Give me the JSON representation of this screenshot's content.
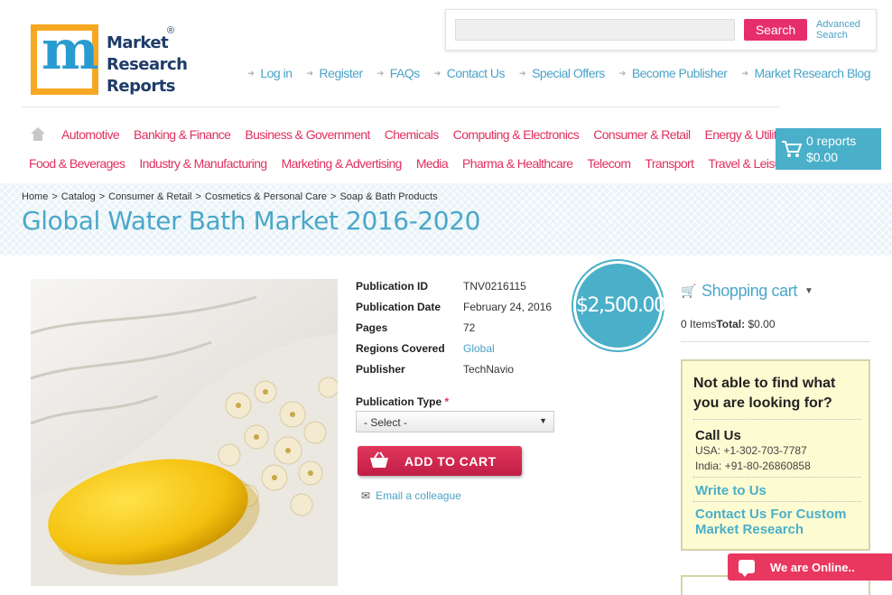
{
  "brand": {
    "line1": "Market",
    "line2": "Research",
    "line3": "Reports",
    "reg": "®"
  },
  "search": {
    "placeholder": "",
    "button": "Search",
    "advanced_line1": "Advanced",
    "advanced_line2": "Search"
  },
  "top_links": [
    "Log in",
    "Register",
    "FAQs",
    "Contact Us",
    "Special Offers",
    "Become Publisher",
    "Market Research Blog"
  ],
  "categories_row1": [
    "Automotive",
    "Banking & Finance",
    "Business & Government",
    "Chemicals",
    "Computing & Electronics",
    "Consumer & Retail",
    "Energy & Utilities"
  ],
  "categories_row2": [
    "Food & Beverages",
    "Industry & Manufacturing",
    "Marketing & Advertising",
    "Media",
    "Pharma & Healthcare",
    "Telecom",
    "Transport",
    "Travel & Leisure"
  ],
  "cart": {
    "reports": "0 reports",
    "total": "$0.00"
  },
  "breadcrumb": [
    "Home",
    "Catalog",
    "Consumer & Retail",
    "Cosmetics & Personal Care",
    "Soap & Bath Products"
  ],
  "page_title": "Global Water Bath Market 2016-2020",
  "details": {
    "publication_id_label": "Publication ID",
    "publication_id": "TNV0216115",
    "publication_date_label": "Publication Date",
    "publication_date": "February 24, 2016",
    "pages_label": "Pages",
    "pages": "72",
    "regions_label": "Regions Covered",
    "regions": "Global",
    "publisher_label": "Publisher",
    "publisher": "TechNavio"
  },
  "publication_type": {
    "label": "Publication Type",
    "required": "*",
    "selected": "- Select -"
  },
  "add_to_cart": "ADD TO CART",
  "email_colleague": "Email a colleague",
  "price": "$2,500.00",
  "shopping_cart": {
    "title": "Shopping cart",
    "items": "0 Items",
    "total_label": "Total:",
    "total": "$0.00"
  },
  "help": {
    "question": "Not able to find what you are looking for?",
    "call_us": "Call Us",
    "usa": "USA: +1-302-703-7787",
    "india": "India: +91-80-26860858",
    "write": "Write to Us",
    "custom": "Contact Us For Custom Market Research"
  },
  "chat": "We are Online.."
}
